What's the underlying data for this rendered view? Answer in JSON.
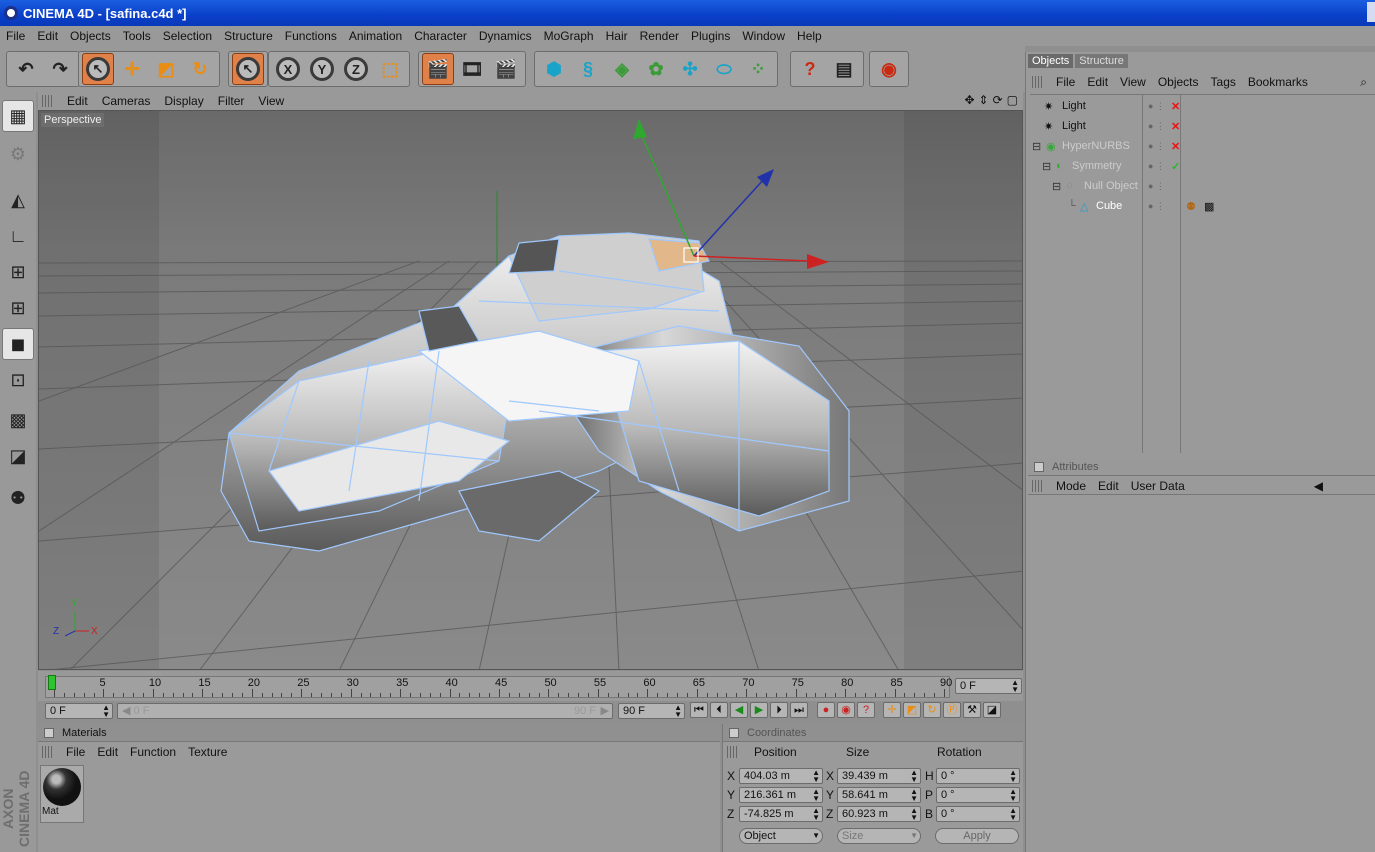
{
  "window": {
    "title": "CINEMA 4D - [safina.c4d *]"
  },
  "menu": [
    "File",
    "Edit",
    "Objects",
    "Tools",
    "Selection",
    "Structure",
    "Functions",
    "Animation",
    "Character",
    "Dynamics",
    "MoGraph",
    "Hair",
    "Render",
    "Plugins",
    "Window",
    "Help"
  ],
  "toolbar": {
    "icons": [
      "undo-icon",
      "redo-icon",
      "live-selection-icon",
      "move-icon",
      "scale-icon",
      "rotate-icon",
      "selected-tool-icon",
      "x-axis-lock-icon",
      "y-axis-lock-icon",
      "z-axis-lock-icon",
      "coordinate-system-icon",
      "render-view-icon",
      "render-picture-viewer-icon",
      "render-settings-icon",
      "cube-primitive-icon",
      "spline-icon",
      "nurbs-icon",
      "array-icon",
      "deformer-icon",
      "scene-icon",
      "environment-icon",
      "help-icon",
      "layer-browser-icon",
      "web-icon"
    ],
    "axis_labels": [
      "X",
      "Y",
      "Z"
    ]
  },
  "viewport": {
    "menu": [
      "Edit",
      "Cameras",
      "Display",
      "Filter",
      "View"
    ],
    "label": "Perspective",
    "axis_gizmo": {
      "x": "X",
      "y": "Y",
      "z": "Z"
    }
  },
  "timeline": {
    "ticks": [
      0,
      5,
      10,
      15,
      20,
      25,
      30,
      35,
      40,
      45,
      50,
      55,
      60,
      65,
      70,
      75,
      80,
      85,
      90
    ],
    "current_frame_field": "0 F",
    "start_field": "0 F",
    "range_min": "0 F",
    "range_max": "90 F",
    "end_field": "90 F"
  },
  "materials": {
    "title": "Materials",
    "menu": [
      "File",
      "Edit",
      "Function",
      "Texture"
    ],
    "items": [
      {
        "name": "Mat"
      }
    ]
  },
  "coordinates": {
    "title": "Coordinates",
    "columns": [
      "Position",
      "Size",
      "Rotation"
    ],
    "rows": [
      {
        "axis": "X",
        "position": "404.03 m",
        "size_axis": "X",
        "size": "39.439 m",
        "rot_axis": "H",
        "rotation": "0 °"
      },
      {
        "axis": "Y",
        "position": "216.361 m",
        "size_axis": "Y",
        "size": "58.641 m",
        "rot_axis": "P",
        "rotation": "0 °"
      },
      {
        "axis": "Z",
        "position": "-74.825 m",
        "size_axis": "Z",
        "size": "60.923 m",
        "rot_axis": "B",
        "rotation": "0 °"
      }
    ],
    "mode_select": "Object",
    "size_select": "Size",
    "apply_label": "Apply"
  },
  "objects_panel": {
    "tabs": [
      "Objects",
      "Structure"
    ],
    "menu": [
      "File",
      "Edit",
      "View",
      "Objects",
      "Tags",
      "Bookmarks"
    ],
    "tree": [
      {
        "name": "Light",
        "indent": 0,
        "status": "x"
      },
      {
        "name": "Light",
        "indent": 0,
        "status": "x"
      },
      {
        "name": "HyperNURBS",
        "indent": 0,
        "status": "x",
        "dim": true
      },
      {
        "name": "Symmetry",
        "indent": 1,
        "status": "check",
        "dim": true
      },
      {
        "name": "Null Object",
        "indent": 2,
        "status": "",
        "dim": true
      },
      {
        "name": "Cube",
        "indent": 3,
        "status": "",
        "dim": false
      }
    ]
  },
  "attributes_panel": {
    "title": "Attributes",
    "menu": [
      "Mode",
      "Edit",
      "User Data"
    ]
  },
  "colors": {
    "accent": "#e0814a",
    "title_bar": "#0a3fc9",
    "selection_wire": "#9fc8ff"
  }
}
